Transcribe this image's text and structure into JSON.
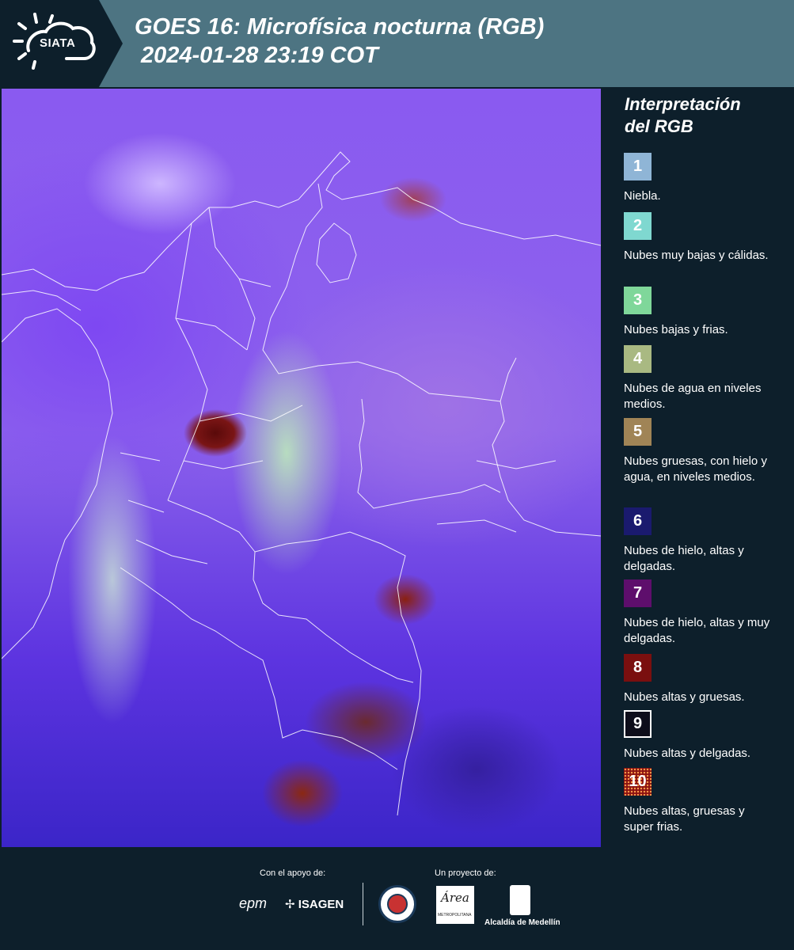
{
  "header": {
    "logo_text": "SIATA",
    "title_line1": "GOES 16: Microfísica nocturna (RGB)",
    "title_line2": "2024-01-28 23:19 COT"
  },
  "legend": {
    "title_line1": "Interpretación",
    "title_line2": "del RGB",
    "items": [
      {
        "num": "1",
        "label": "Niebla.",
        "color": "#8fb5d6"
      },
      {
        "num": "2",
        "label": "Nubes muy bajas y cálidas.",
        "color": "#7fd8d0"
      },
      {
        "num": "3",
        "label": "Nubes bajas y frias.",
        "color": "#7fd79a"
      },
      {
        "num": "4",
        "label": "Nubes de agua en niveles medios.",
        "color": "#a9b982"
      },
      {
        "num": "5",
        "label": "Nubes gruesas, con hielo y agua, en niveles medios.",
        "color": "#a08456"
      },
      {
        "num": "6",
        "label": "Nubes de hielo, altas y delgadas.",
        "color": "#1a1a6e"
      },
      {
        "num": "7",
        "label": "Nubes de hielo, altas y muy delgadas.",
        "color": "#5e0e6c"
      },
      {
        "num": "8",
        "label": "Nubes altas y gruesas.",
        "color": "#7a0f0f"
      },
      {
        "num": "9",
        "label": "Nubes altas y delgadas.",
        "color": "#0d0d1a"
      },
      {
        "num": "10",
        "label": "Nubes altas, gruesas y super frias.",
        "color": "#8a1212"
      }
    ]
  },
  "footer": {
    "support_label": "Con el apoyo de:",
    "project_label": "Un proyecto de:",
    "sponsor1": "epm",
    "sponsor2": "ISAGEN",
    "metro_line1": "Área",
    "metro_line2": "METROPOLITANA",
    "alcaldia": "Alcaldía de Medellín"
  }
}
